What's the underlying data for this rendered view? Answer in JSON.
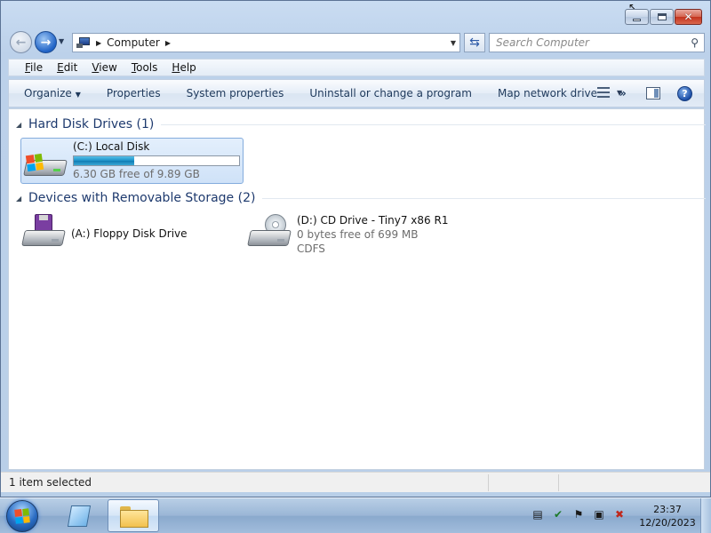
{
  "window": {
    "caption_buttons": [
      "minimize-icon",
      "maximize-icon",
      "close-icon"
    ],
    "close_glyph": "✕"
  },
  "navigation": {
    "back_glyph": "←",
    "forward_glyph": "→",
    "history_glyph": "▼",
    "address": {
      "icon": "computer-icon",
      "location": "Computer",
      "separator_glyph": "▶",
      "dropdown_glyph": "▼"
    },
    "refresh_glyph": "⇆",
    "search": {
      "placeholder": "Search Computer",
      "icon_glyph": "⚲"
    }
  },
  "menu": {
    "items": [
      {
        "label": "File",
        "underline": "F",
        "rest": "ile"
      },
      {
        "label": "Edit",
        "underline": "E",
        "rest": "dit"
      },
      {
        "label": "View",
        "underline": "V",
        "rest": "iew"
      },
      {
        "label": "Tools",
        "underline": "T",
        "rest": "ools"
      },
      {
        "label": "Help",
        "underline": "H",
        "rest": "elp"
      }
    ]
  },
  "commands": {
    "organize": "Organize",
    "dropdown_glyph": "▼",
    "properties": "Properties",
    "system_properties": "System properties",
    "uninstall": "Uninstall or change a program",
    "map_drive": "Map network drive",
    "more": "»",
    "views_dropdown": "▼",
    "help": "?"
  },
  "groups": {
    "hard_disks": {
      "title": "Hard Disk Drives (1)",
      "toggle_glyph": "◢",
      "drives": [
        {
          "name": "(C:) Local Disk",
          "free_text": "6.30 GB free of 9.89 GB",
          "used_fraction": 0.363,
          "icon": "hard-drive-windows-icon"
        }
      ]
    },
    "removable": {
      "title": "Devices with Removable Storage (2)",
      "toggle_glyph": "◢",
      "drives": [
        {
          "name": "(A:) Floppy Disk Drive",
          "icon": "floppy-drive-icon"
        },
        {
          "name": "(D:) CD Drive - Tiny7 x86 R1",
          "free_text": "0 bytes free of 699 MB",
          "filesystem": "CDFS",
          "icon": "cd-drive-icon"
        }
      ]
    }
  },
  "status": {
    "text": "1 item selected"
  },
  "taskbar": {
    "clock_time": "23:37",
    "clock_date": "12/20/2023",
    "tray_icons": [
      "document-icon",
      "shield-icon",
      "flag-icon",
      "network-icon",
      "volume-muted-icon"
    ],
    "tray_glyphs": [
      "▤",
      "✔",
      "⚑",
      "▣",
      "✖"
    ]
  },
  "colors": {
    "accent": "#1e3a6e",
    "capacity_fill": "#1b8fc6",
    "close_button": "#c3331d"
  }
}
